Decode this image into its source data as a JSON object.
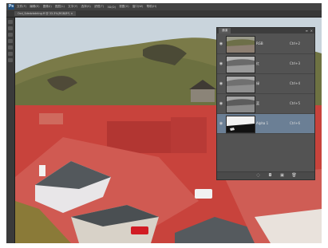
{
  "app": {
    "logo": "Ps",
    "menu": [
      "文件(F)",
      "编辑(E)",
      "图像(I)",
      "图层(L)",
      "文字(Y)",
      "选择(S)",
      "滤镜(T)",
      "3D(D)",
      "视图(V)",
      "窗口(W)",
      "帮助(H)"
    ]
  },
  "document": {
    "tab_title": "Ocd_Sdedzbdntng.ff @ 33.3%(RGB/8*) ×"
  },
  "channels_panel": {
    "tab_label": "通道",
    "close_glyph": "×",
    "menu_glyph": "≡",
    "channels": [
      {
        "name": "RGB",
        "shortcut": "Ctrl+2",
        "selected": false
      },
      {
        "name": "红",
        "shortcut": "Ctrl+3",
        "selected": false
      },
      {
        "name": "绿",
        "shortcut": "Ctrl+4",
        "selected": false
      },
      {
        "name": "蓝",
        "shortcut": "Ctrl+5",
        "selected": false
      },
      {
        "name": "Alpha 1",
        "shortcut": "Ctrl+6",
        "selected": true
      }
    ],
    "footer_icons": [
      "dotted-circle-icon",
      "save-selection-icon",
      "new-channel-icon",
      "trash-icon"
    ],
    "footer_glyphs": [
      "◌",
      "◘",
      "▣",
      "🗑"
    ]
  },
  "colors": {
    "selection_overlay": "#d81e1e",
    "selected_channel_bg": "#6b7f95"
  }
}
